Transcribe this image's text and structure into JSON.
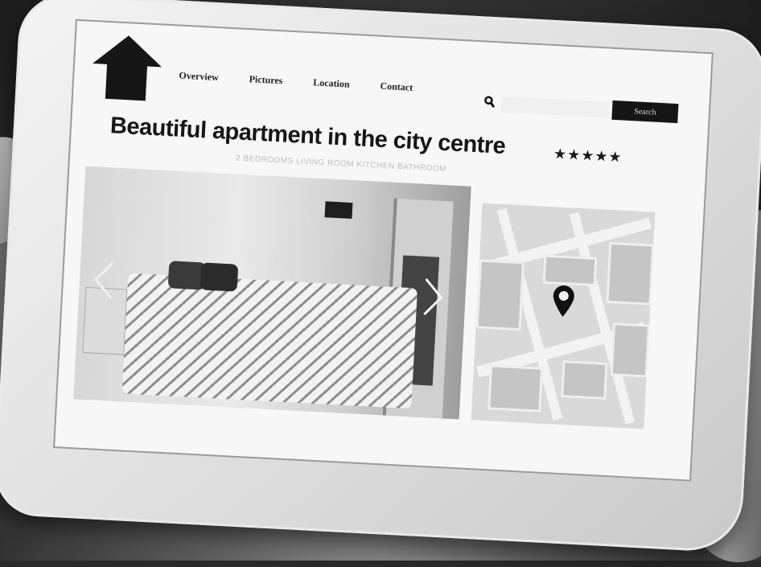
{
  "nav": {
    "items": [
      "Overview",
      "Pictures",
      "Location",
      "Contact"
    ]
  },
  "search": {
    "placeholder": "",
    "button_label": "Search"
  },
  "listing": {
    "title": "Beautiful apartment in the city centre",
    "stars": "★★★★★",
    "rating": 5,
    "subtitle": "2 BEDROOMS LIVING ROOM KITCHEN BATHROOM"
  },
  "gallery": {
    "prev_icon": "chevron-left-icon",
    "next_icon": "chevron-right-icon"
  },
  "map": {
    "icon": "location-pin-icon"
  },
  "colors": {
    "button_bg": "#151515",
    "title": "#161616"
  }
}
